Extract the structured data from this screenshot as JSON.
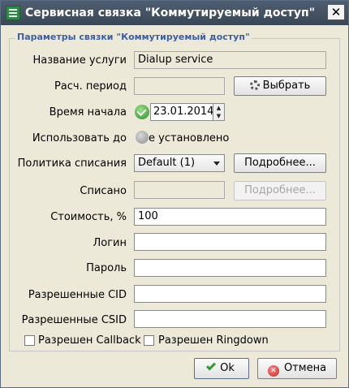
{
  "window": {
    "title": "Сервисная связка \"Коммутируемый доступ\"",
    "close": "✕"
  },
  "group": {
    "title": "Параметры связки \"Коммутируемый доступ\""
  },
  "form": {
    "service_name": {
      "label": "Название услуги",
      "value": "Dialup service"
    },
    "billing_period": {
      "label": "Расч. период",
      "value": "",
      "button": "Выбрать"
    },
    "start_time": {
      "label": "Время начала",
      "value": "23.01.2014"
    },
    "use_until": {
      "label": "Использовать до",
      "value": "е установлено"
    },
    "charge_policy": {
      "label": "Политика списания",
      "value": "Default (1)",
      "button": "Подробнее..."
    },
    "charged": {
      "label": "Списано",
      "value": "",
      "button": "Подробнее..."
    },
    "cost": {
      "label": "Стоимость, %",
      "value": "100"
    },
    "login": {
      "label": "Логин",
      "value": ""
    },
    "password": {
      "label": "Пароль",
      "value": ""
    },
    "allowed_cid": {
      "label": "Разрешенные CID",
      "value": ""
    },
    "allowed_csid": {
      "label": "Разрешенные CSID",
      "value": ""
    }
  },
  "options": {
    "callback": {
      "label": "Разрешен Callback",
      "checked": false
    },
    "ringdown": {
      "label": "Разрешен Ringdown",
      "checked": false
    }
  },
  "footer": {
    "ok": "Ok",
    "cancel": "Отмена"
  },
  "icons": [
    "app-icon",
    "close-icon",
    "gear-icon",
    "checkmark-icon",
    "cancel-icon"
  ],
  "colors": {
    "titlebar": "#3f4c5e",
    "window_bg": "#ece9d8",
    "group_title": "#3d5ea6"
  }
}
